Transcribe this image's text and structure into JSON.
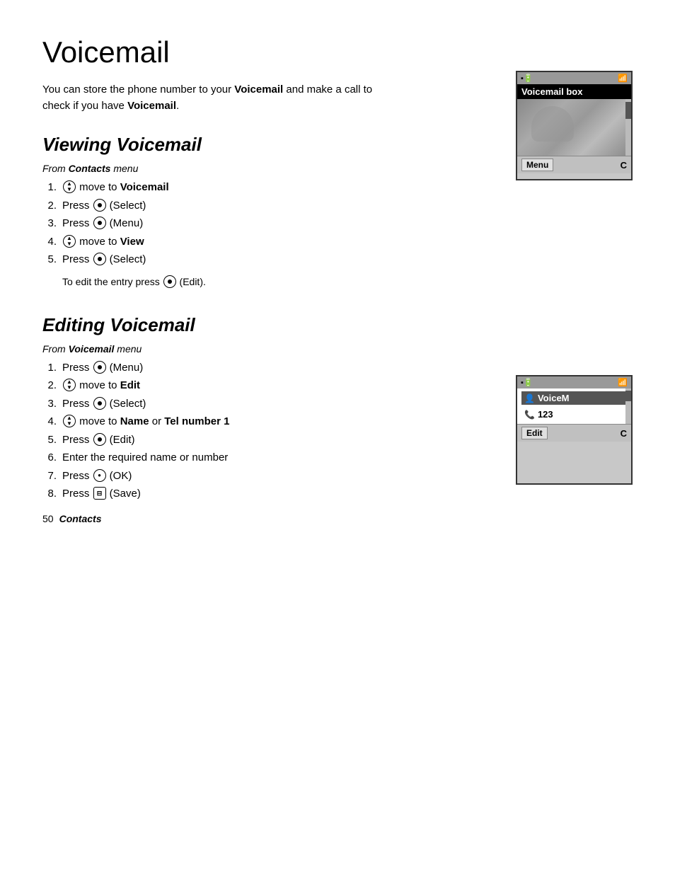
{
  "page": {
    "title": "Voicemail",
    "intro": {
      "text1": "You can store the phone number to your ",
      "bold1": "Voicemail",
      "text2": " and make a call to check if you have ",
      "bold2": "Voicemail",
      "text3": "."
    },
    "section1": {
      "heading": "Viewing Voicemail",
      "from_menu_prefix": "From ",
      "from_menu_bold": "Contacts",
      "from_menu_suffix": " menu",
      "steps": [
        {
          "num": "1.",
          "before": "",
          "icon": "nav",
          "after": " move to ",
          "bold": "Voicemail",
          "rest": ""
        },
        {
          "num": "2.",
          "before": "Press ",
          "icon": "select",
          "after": " (Select)",
          "bold": "",
          "rest": ""
        },
        {
          "num": "3.",
          "before": "Press ",
          "icon": "select",
          "after": " (Menu)",
          "bold": "",
          "rest": ""
        },
        {
          "num": "4.",
          "before": "",
          "icon": "nav",
          "after": " move to ",
          "bold": "View",
          "rest": ""
        },
        {
          "num": "5.",
          "before": "Press ",
          "icon": "select",
          "after": " (Select)",
          "bold": "",
          "rest": ""
        }
      ],
      "note": "To edit the entry press ⊙ (Edit)."
    },
    "section2": {
      "heading": "Editing Voicemail",
      "from_menu_prefix": "From ",
      "from_menu_bold": "Voicemail",
      "from_menu_suffix": " menu",
      "steps": [
        {
          "num": "1.",
          "before": "Press ",
          "icon": "select",
          "after": " (Menu)",
          "bold": "",
          "rest": ""
        },
        {
          "num": "2.",
          "before": "",
          "icon": "nav",
          "after": " move to ",
          "bold": "Edit",
          "rest": ""
        },
        {
          "num": "3.",
          "before": "Press ",
          "icon": "select",
          "after": " (Select)",
          "bold": "",
          "rest": ""
        },
        {
          "num": "4.",
          "before": "",
          "icon": "nav",
          "after": " move to ",
          "bold": "Name",
          "rest": " or ",
          "bold2": "Tel number 1"
        },
        {
          "num": "5.",
          "before": "Press ",
          "icon": "select",
          "after": " (Edit)",
          "bold": "",
          "rest": ""
        },
        {
          "num": "6.",
          "before": "Enter the required name or number",
          "icon": "",
          "after": "",
          "bold": "",
          "rest": ""
        },
        {
          "num": "7.",
          "before": "Press ",
          "icon": "ok",
          "after": " (OK)",
          "bold": "",
          "rest": ""
        },
        {
          "num": "8.",
          "before": "Press ",
          "icon": "save",
          "after": " (Save)",
          "bold": "",
          "rest": ""
        }
      ]
    },
    "screen1": {
      "title": "Voicemail box",
      "footer_left": "Menu",
      "footer_right": "C"
    },
    "screen2": {
      "row1_icon": "👤",
      "row1_text": "VoiceM",
      "row2_icon": "📞",
      "row2_text": "123",
      "footer_left": "Edit",
      "footer_right": "C"
    },
    "footer": {
      "page_number": "50",
      "chapter": "Contacts"
    }
  }
}
